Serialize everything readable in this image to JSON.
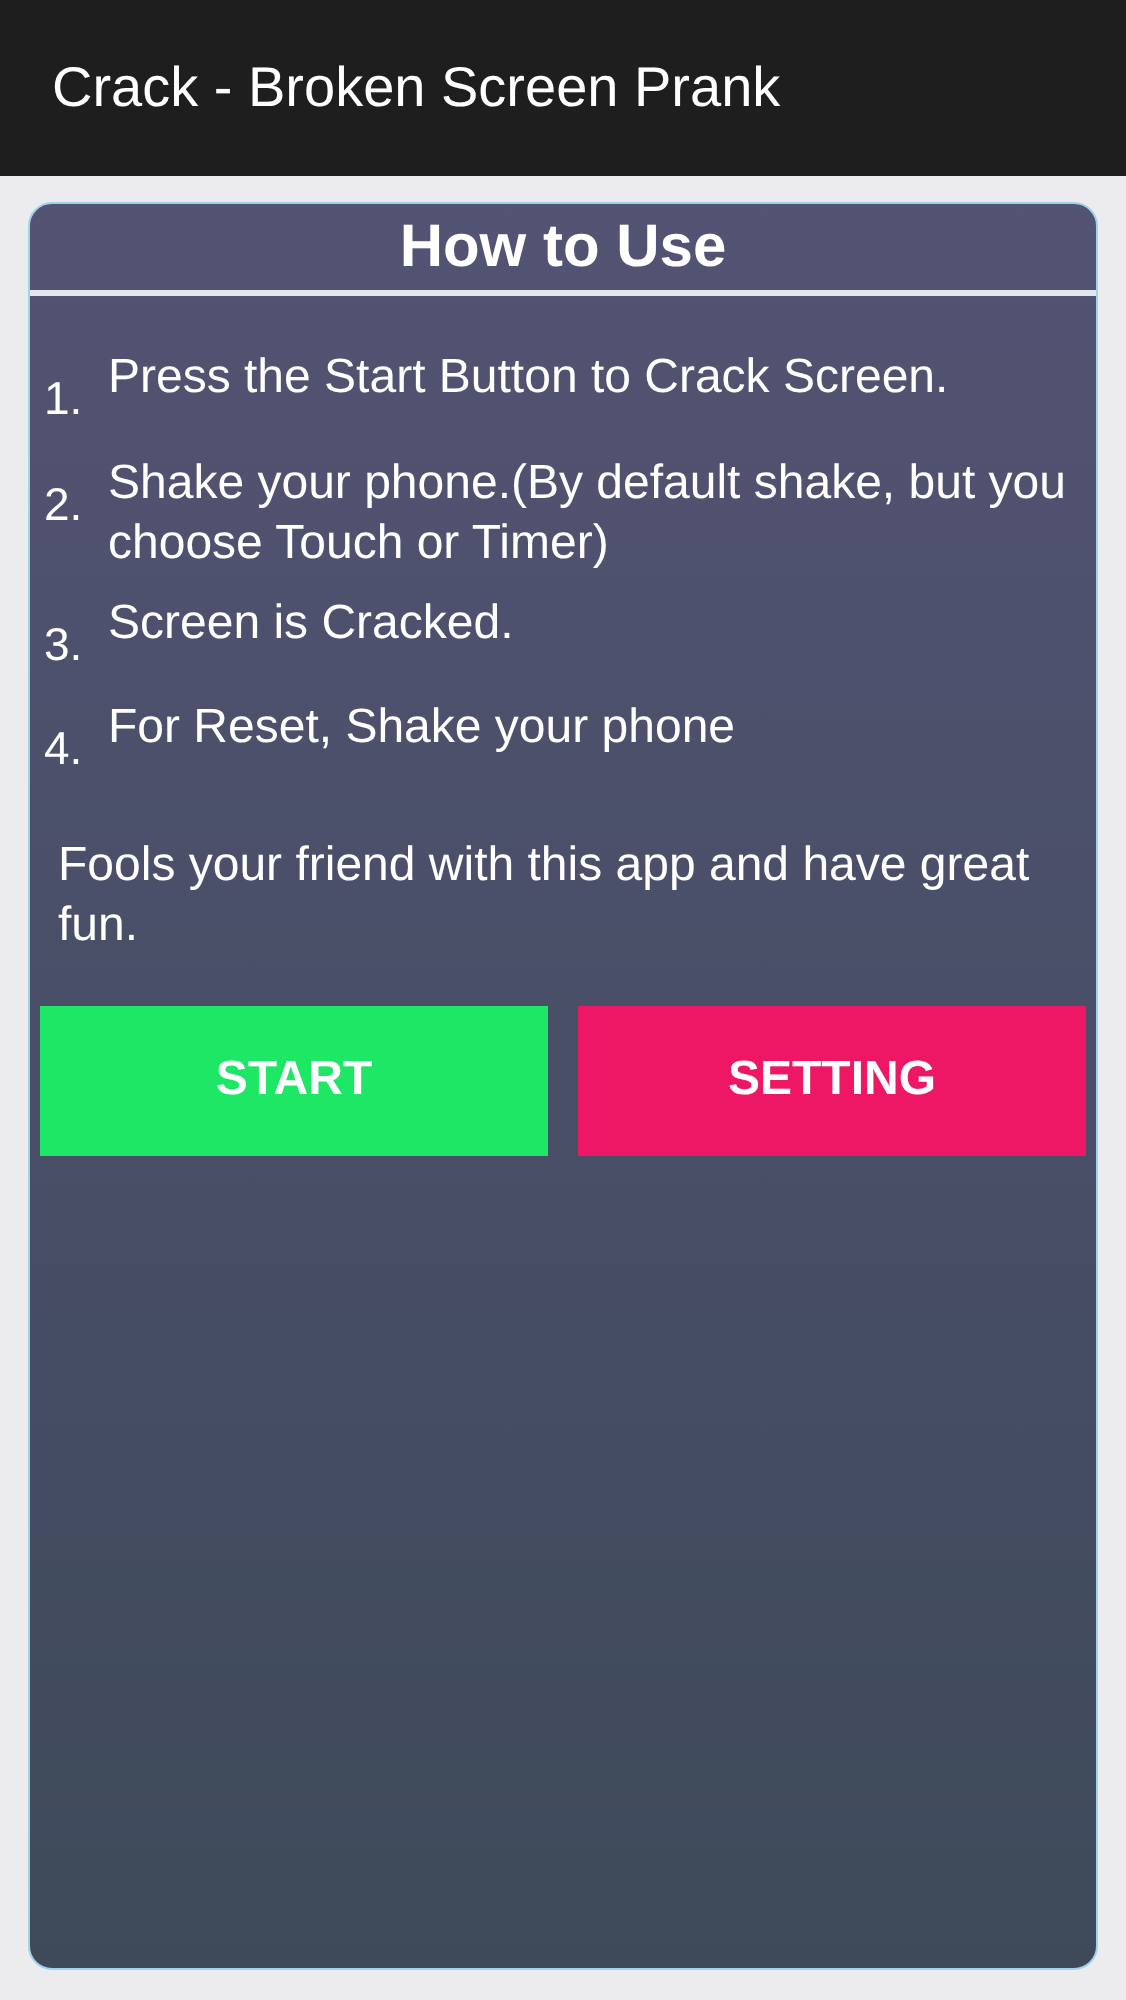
{
  "app_bar": {
    "title": "Crack - Broken Screen Prank"
  },
  "card": {
    "title": "How to Use",
    "steps": [
      {
        "number": "1.",
        "text": "Press the Start Button to Crack Screen."
      },
      {
        "number": "2.",
        "text": "Shake your phone.(By default shake, but you choose Touch or Timer)"
      },
      {
        "number": "3.",
        "text": "Screen is Cracked."
      },
      {
        "number": "4.",
        "text": "For Reset, Shake your phone"
      }
    ],
    "note": "Fools your friend with this app and have great fun.",
    "buttons": [
      {
        "label": "START",
        "color": "#1de765"
      },
      {
        "label": "SETTING",
        "color": "#ed1765"
      }
    ]
  }
}
